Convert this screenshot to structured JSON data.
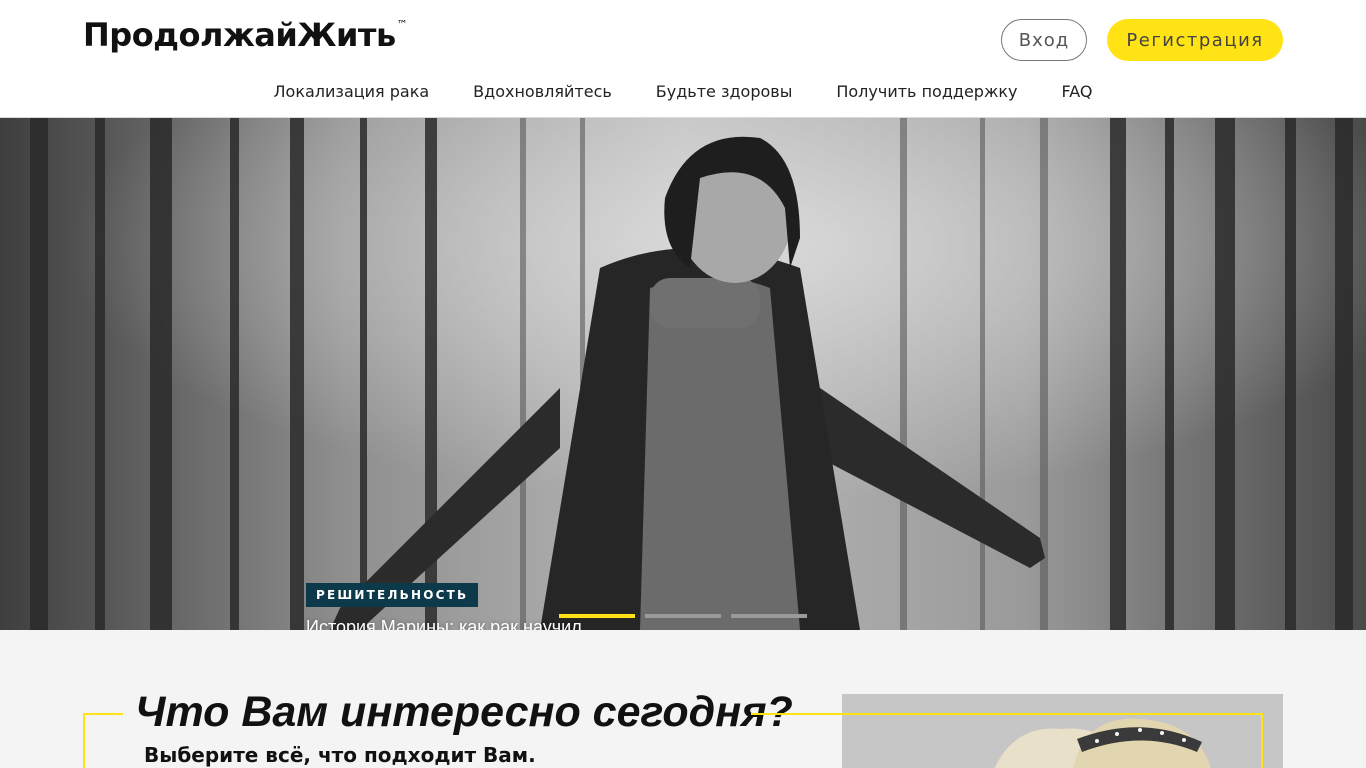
{
  "header": {
    "logo": "ПродолжайЖить",
    "logo_mark": "™",
    "login_label": "Вход",
    "register_label": "Регистрация",
    "colors": {
      "accent": "#ffe314",
      "tag_bg": "#0d3a4a"
    }
  },
  "nav": {
    "items": [
      {
        "label": "Локализация рака"
      },
      {
        "label": "Вдохновляйтесь"
      },
      {
        "label": "Будьте здоровы"
      },
      {
        "label": "Получить поддержку"
      },
      {
        "label": "FAQ"
      }
    ]
  },
  "hero": {
    "tag": "РЕШИТЕЛЬНОСТЬ",
    "title": "История Марины: как рак научил принимать взвешенные решения и ценить счастливые моменты жизни",
    "slides_total": 3,
    "active_slide": 1
  },
  "interests": {
    "title": "Что Вам интересно сегодня?",
    "subtitle": "Выберите всё, что подходит Вам."
  }
}
